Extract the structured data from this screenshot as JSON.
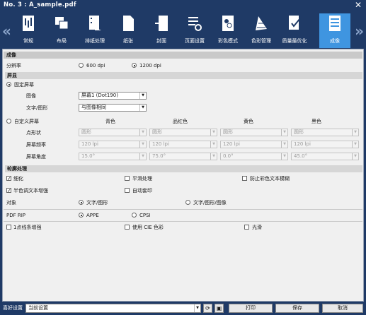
{
  "window": {
    "title": "No. 3 : A_sample.pdf",
    "close": "✕"
  },
  "tabs": [
    {
      "label": "常规",
      "icon": "general-icon"
    },
    {
      "label": "布局",
      "icon": "layout-icon"
    },
    {
      "label": "排纸处理",
      "icon": "finishing-icon"
    },
    {
      "label": "纸张",
      "icon": "paper-icon"
    },
    {
      "label": "封面",
      "icon": "cover-icon"
    },
    {
      "label": "页面设置",
      "icon": "page-setup-icon"
    },
    {
      "label": "彩色模式",
      "icon": "color-mode-icon"
    },
    {
      "label": "色彩管理",
      "icon": "color-management-icon"
    },
    {
      "label": "质量最优化",
      "icon": "quality-icon"
    },
    {
      "label": "成像",
      "icon": "imaging-icon",
      "active": true
    }
  ],
  "nav": {
    "left": "«",
    "right": "»"
  },
  "imaging": {
    "header": "成像",
    "resolution": {
      "label": "分辨率",
      "opt1": "600 dpi",
      "opt2": "1200 dpi",
      "selected": "1200 dpi"
    },
    "screen": {
      "header": "屏显",
      "fixed": "固定屏幕",
      "image_label": "图像",
      "image_value": "屏幕1 (Dot190)",
      "text_label": "文字/图形",
      "text_value": "与图像相同",
      "custom": "自定义屏幕",
      "colors": [
        "青色",
        "品红色",
        "黄色",
        "黑色"
      ],
      "shape_label": "点形状",
      "freq_label": "屏幕频率",
      "angle_label": "屏幕角度",
      "shape_values": [
        "圆形",
        "圆形",
        "圆形",
        "圆形"
      ],
      "freq_values": [
        "120 lpi",
        "120 lpi",
        "120 lpi",
        "120 lpi"
      ],
      "angle_values": [
        "15.0°",
        "75.0°",
        "0.0°",
        "45.0°"
      ]
    },
    "edge": {
      "header": "轮廓处理",
      "thin": "细化",
      "smooth": "平滑处理",
      "prevent_blur": "防止彩色文本模糊",
      "halftone": "半色调文本增强",
      "trap": "自动套印",
      "target_label": "对象",
      "target1": "文字/图形",
      "target2": "文字/图形/图像"
    },
    "rip": {
      "label": "PDF RIP",
      "opt1": "APPE",
      "opt2": "CPSI",
      "selected": "APPE"
    },
    "extra": {
      "dot_line": "1点线条增强",
      "cie": "使用 CIE 色彩",
      "gloss": "光滑"
    }
  },
  "footer": {
    "pref_label": "喜好设置",
    "pref_value": "当前设置",
    "print": "打印",
    "save": "保存",
    "cancel": "取消"
  }
}
